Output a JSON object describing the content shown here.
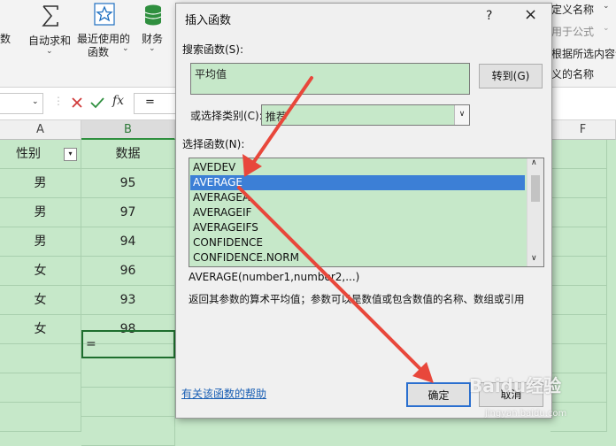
{
  "ribbon": {
    "partial_left": "数",
    "autosum_label": "自动求和",
    "recent_label_1": "最近使用的",
    "recent_label_2": "函数",
    "finance_label": "财务",
    "right_1": "定义名称",
    "right_2": "用于公式",
    "right_3": "根据所选内容创",
    "right_4": "义的名称"
  },
  "formula_bar": {
    "fx": "fx",
    "content": "="
  },
  "sheet": {
    "col_a": "A",
    "col_b": "B",
    "col_f": "F",
    "header_a": "性别",
    "header_b": "数据",
    "rows": [
      {
        "a": "男",
        "b": "95"
      },
      {
        "a": "男",
        "b": "97"
      },
      {
        "a": "男",
        "b": "94"
      },
      {
        "a": "女",
        "b": "96"
      },
      {
        "a": "女",
        "b": "93"
      },
      {
        "a": "女",
        "b": "98"
      }
    ],
    "active_cell": "="
  },
  "dialog": {
    "title": "插入函数",
    "help_q": "?",
    "close": "×",
    "search_label": "搜索函数(S):",
    "search_value": "平均值",
    "go_button": "转到(G)",
    "category_label": "或选择类别(C):",
    "category_value": "推荐",
    "select_label": "选择函数(N):",
    "functions": [
      "AVEDEV",
      "AVERAGE",
      "AVERAGEA",
      "AVERAGEIF",
      "AVERAGEIFS",
      "CONFIDENCE",
      "CONFIDENCE.NORM"
    ],
    "selected_function": "AVERAGE",
    "syntax": "AVERAGE(number1,number2,...)",
    "description": "返回其参数的算术平均值；参数可以是数值或包含数值的名称、数组或引用",
    "help_link": "有关该函数的帮助",
    "ok_button": "确定",
    "cancel_button": "取消"
  },
  "watermark": {
    "text": "Baidu经验",
    "url": "jingyan.baidu.com"
  },
  "colors": {
    "accent": "#3c7fd6",
    "arrow": "#e8473b",
    "cell_bg": "#c6e8c9"
  }
}
